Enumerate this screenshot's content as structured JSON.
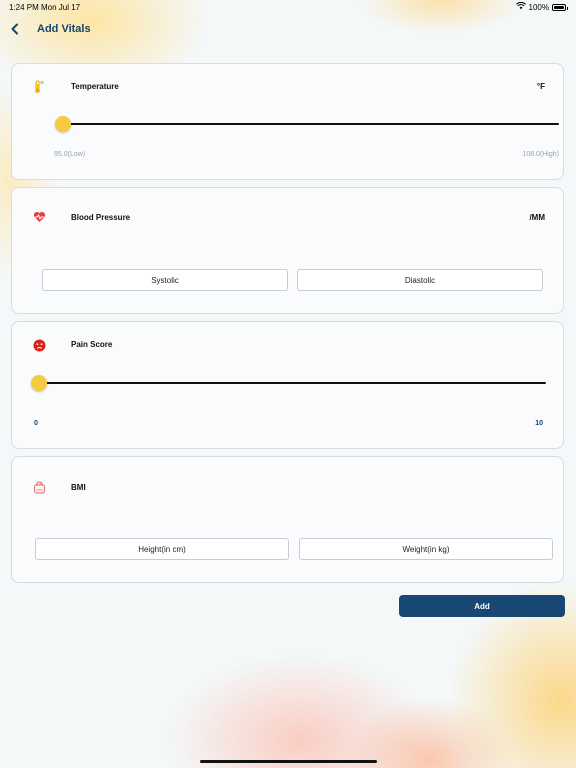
{
  "status_bar": {
    "time": "1:24 PM",
    "date": "Mon Jul 17",
    "battery": "100%",
    "battery_level": 1.0
  },
  "nav": {
    "back_icon": "chevron-left-icon",
    "title": "Add Vitals"
  },
  "temperature": {
    "icon": "thermometer-icon",
    "title": "Temperature",
    "unit": "°F",
    "min_label": "95.0(Low)",
    "max_label": "108.0(High)",
    "min": 95.0,
    "max": 108.0,
    "value": 95.0
  },
  "blood_pressure": {
    "icon": "heart-pulse-icon",
    "title": "Blood Pressure",
    "unit": "/MM",
    "systolic_placeholder": "Systolic",
    "diastolic_placeholder": "Diastolic"
  },
  "pain_score": {
    "icon": "sad-face-icon",
    "title": "Pain Score",
    "min_label": "0",
    "max_label": "10",
    "min": 0,
    "max": 10,
    "value": 0
  },
  "bmi": {
    "icon": "scale-icon",
    "title": "BMI",
    "height_placeholder": "Height(in cm)",
    "weight_placeholder": "Weight(in kg)"
  },
  "add_button": {
    "label": "Add"
  },
  "colors": {
    "primary": "#184773",
    "title": "#15446e",
    "slider_thumb": "#f7cb3f",
    "heart": "#e2403d",
    "pain": "#d6241d"
  }
}
